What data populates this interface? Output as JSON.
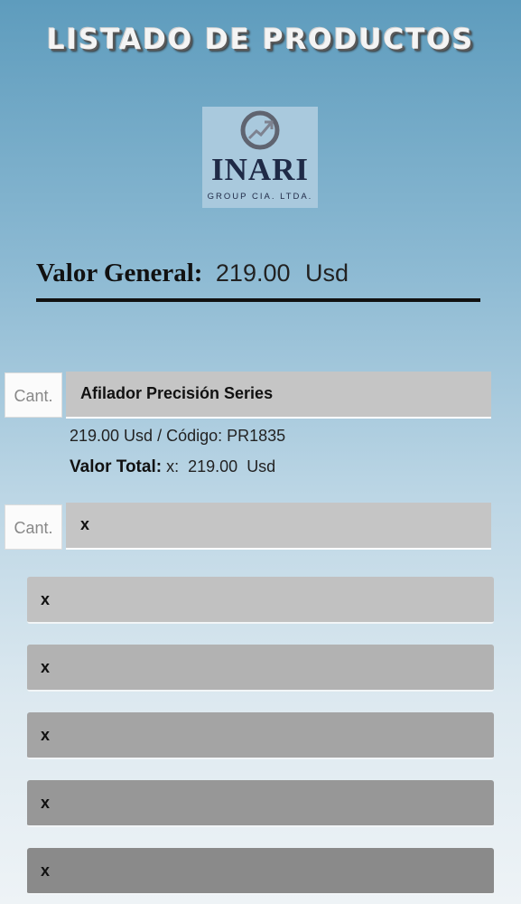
{
  "page": {
    "title": "LISTADO DE PRODUCTOS"
  },
  "logo": {
    "name": "INARI",
    "subtitle": "GROUP CIA. LTDA."
  },
  "summary": {
    "label": "Valor General:",
    "value": "219.00",
    "unit": "Usd"
  },
  "products": [
    {
      "qty_placeholder": "Cant.",
      "name": "Afilador Precisión Series",
      "price_line": "219.00 Usd / Código: PR1835",
      "total_label": "Valor Total:",
      "total_qty": "x:",
      "total_value": "219.00",
      "total_unit": "Usd"
    },
    {
      "qty_placeholder": "Cant.",
      "name": "x"
    }
  ],
  "list_rows": [
    {
      "label": "x",
      "color": "#c1c1c1"
    },
    {
      "label": "x",
      "color": "#b2b2b2"
    },
    {
      "label": "x",
      "color": "#a4a4a4"
    },
    {
      "label": "x",
      "color": "#979797"
    },
    {
      "label": "x",
      "color": "#8a8a8a"
    }
  ]
}
